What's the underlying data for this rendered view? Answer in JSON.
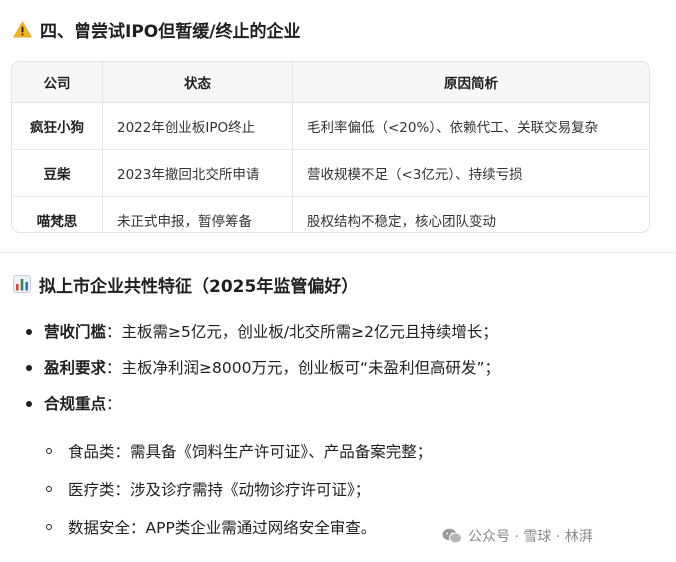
{
  "section1": {
    "icon": "warning-icon",
    "title": "四、曾尝试IPO但暂缓/终止的企业",
    "table": {
      "headers": [
        "公司",
        "状态",
        "原因简析"
      ],
      "rows": [
        {
          "company": "疯狂小狗",
          "status": "2022年创业板IPO终止",
          "reason": "毛利率偏低（<20%）、依赖代工、关联交易复杂"
        },
        {
          "company": "豆柴",
          "status": "2023年撤回北交所申请",
          "reason": "营收规模不足（<3亿元）、持续亏损"
        },
        {
          "company": "喵梵思",
          "status": "未正式申报，暂停筹备",
          "reason": "股权结构不稳定，核心团队变动"
        }
      ]
    }
  },
  "section2": {
    "icon": "bar-chart-icon",
    "title": "拟上市企业共性特征（2025年监管偏好）",
    "items": [
      {
        "label": "营收门槛",
        "text": "：主板需≥5亿元，创业板/北交所需≥2亿元且持续增长；"
      },
      {
        "label": "盈利要求",
        "text": "：主板净利润≥8000万元，创业板可“未盈利但高研发”；"
      },
      {
        "label": "合规重点",
        "text": "："
      }
    ],
    "subitems": [
      "食品类：需具备《饲料生产许可证》、产品备案完整；",
      "医疗类：涉及诊疗需持《动物诊疗许可证》；",
      "数据安全：APP类企业需通过网络安全审查。"
    ]
  },
  "watermark": {
    "icon": "wechat-icon",
    "text": "公众号 · 雪球 · 林湃"
  }
}
